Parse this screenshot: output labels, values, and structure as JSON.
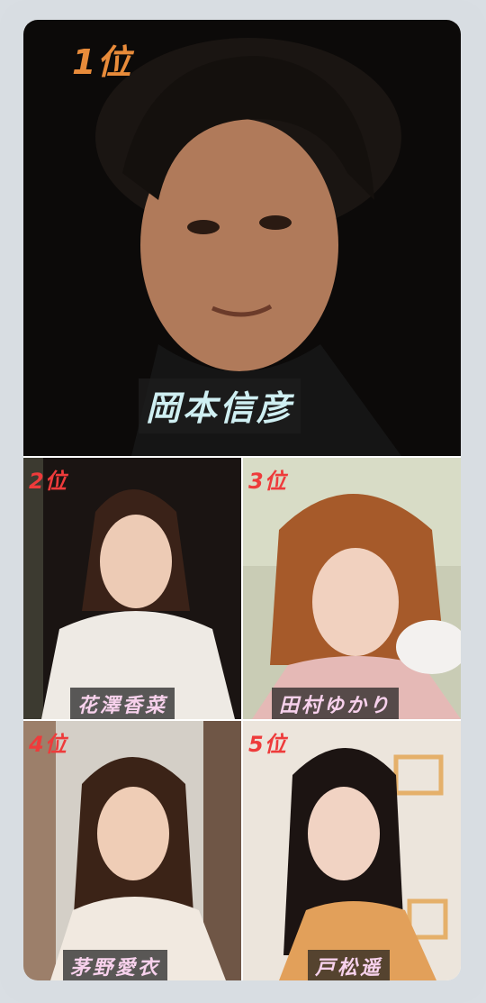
{
  "rankings": [
    {
      "rank_label": "1位",
      "name": "岡本信彦"
    },
    {
      "rank_label": "2位",
      "name": "花澤香菜"
    },
    {
      "rank_label": "3位",
      "name": "田村ゆかり"
    },
    {
      "rank_label": "4位",
      "name": "茅野愛衣"
    },
    {
      "rank_label": "5位",
      "name": "戸松遥"
    }
  ],
  "colors": {
    "frame": "#d8dde2",
    "rank_first": "#e88b3a",
    "rank_other": "#ee3b3b",
    "name_first": "#cfeff2",
    "name_other": "#f7d1ec"
  },
  "icons": [
    "photo-1",
    "photo-2",
    "photo-3",
    "photo-4",
    "photo-5"
  ]
}
